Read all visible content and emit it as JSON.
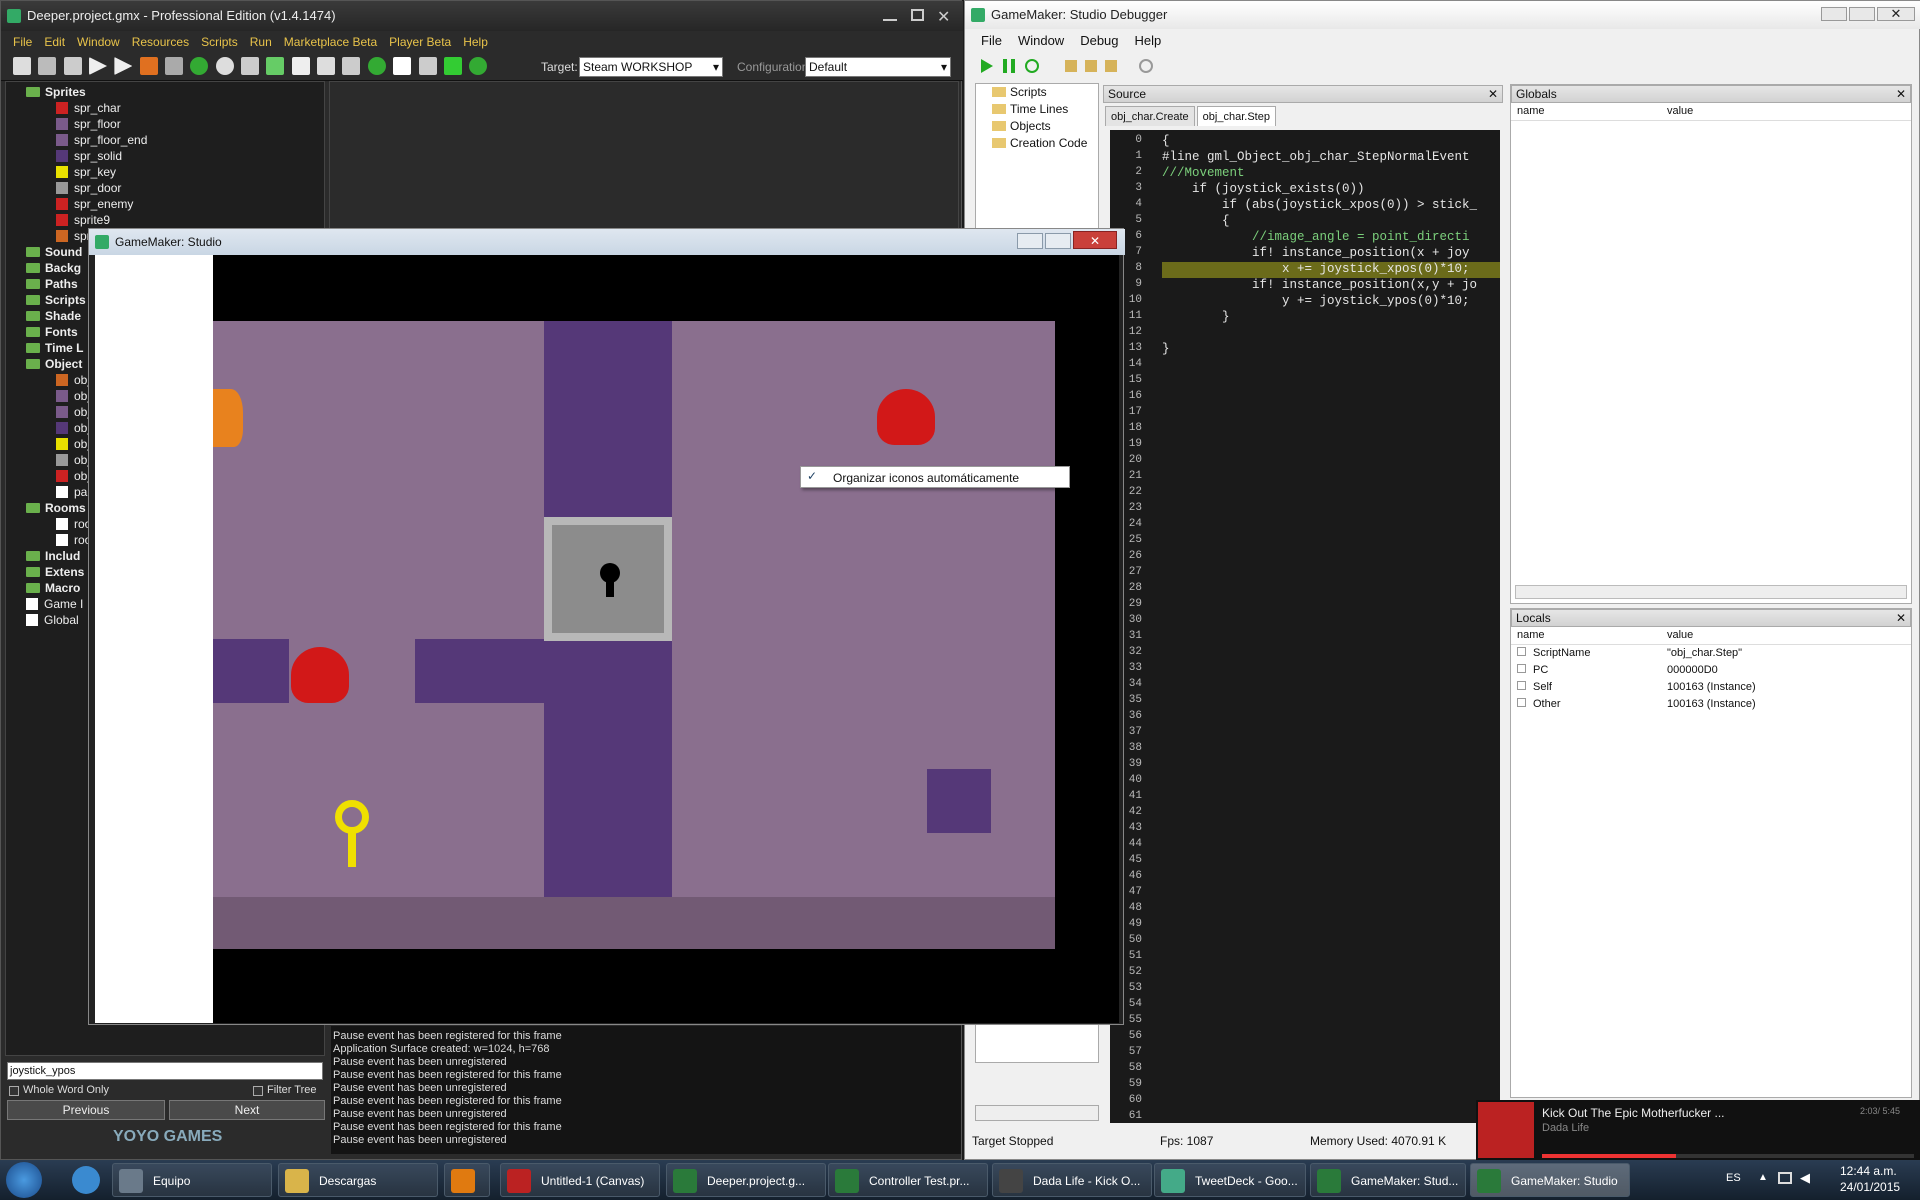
{
  "ide": {
    "title": "Deeper.project.gmx  -  Professional Edition (v1.4.1474)",
    "menu": [
      "File",
      "Edit",
      "Window",
      "Resources",
      "Scripts",
      "Run",
      "Marketplace Beta",
      "Player Beta",
      "Help"
    ],
    "target_label": "Target:",
    "target_value": "Steam WORKSHOP",
    "config_label": "Configuration:",
    "config_value": "Default",
    "tree": [
      {
        "t": "Sprites",
        "lvl": 0,
        "kind": "folder"
      },
      {
        "t": "spr_char",
        "lvl": 1,
        "kind": "spr",
        "c": "#cc2222"
      },
      {
        "t": "spr_floor",
        "lvl": 1,
        "kind": "spr",
        "c": "#7a5a8a"
      },
      {
        "t": "spr_floor_end",
        "lvl": 1,
        "kind": "spr",
        "c": "#7a5a8a"
      },
      {
        "t": "spr_solid",
        "lvl": 1,
        "kind": "spr",
        "c": "#553878"
      },
      {
        "t": "spr_key",
        "lvl": 1,
        "kind": "spr",
        "c": "#e8e000"
      },
      {
        "t": "spr_door",
        "lvl": 1,
        "kind": "spr",
        "c": "#999"
      },
      {
        "t": "spr_enemy",
        "lvl": 1,
        "kind": "spr",
        "c": "#cc2222"
      },
      {
        "t": "sprite9",
        "lvl": 1,
        "kind": "spr",
        "c": "#cc2222"
      },
      {
        "t": "spr",
        "lvl": 1,
        "kind": "spr",
        "c": "#cc6622"
      },
      {
        "t": "Sound",
        "lvl": 0,
        "kind": "folder"
      },
      {
        "t": "Backg",
        "lvl": 0,
        "kind": "folder"
      },
      {
        "t": "Paths",
        "lvl": 0,
        "kind": "folder"
      },
      {
        "t": "Scripts",
        "lvl": 0,
        "kind": "folder"
      },
      {
        "t": "Shade",
        "lvl": 0,
        "kind": "folder"
      },
      {
        "t": "Fonts",
        "lvl": 0,
        "kind": "folder"
      },
      {
        "t": "Time L",
        "lvl": 0,
        "kind": "folder"
      },
      {
        "t": "Object",
        "lvl": 0,
        "kind": "folder"
      },
      {
        "t": "obj",
        "lvl": 1,
        "kind": "spr",
        "c": "#cc6622"
      },
      {
        "t": "obj",
        "lvl": 1,
        "kind": "spr",
        "c": "#7a5a8a"
      },
      {
        "t": "obj",
        "lvl": 1,
        "kind": "spr",
        "c": "#7a5a8a"
      },
      {
        "t": "obj",
        "lvl": 1,
        "kind": "spr",
        "c": "#553878"
      },
      {
        "t": "obj",
        "lvl": 1,
        "kind": "spr",
        "c": "#e8e000"
      },
      {
        "t": "obj",
        "lvl": 1,
        "kind": "spr",
        "c": "#999"
      },
      {
        "t": "obj",
        "lvl": 1,
        "kind": "spr",
        "c": "#cc2222"
      },
      {
        "t": "par",
        "lvl": 1,
        "kind": "spr",
        "c": "#fff"
      },
      {
        "t": "Rooms",
        "lvl": 0,
        "kind": "folder"
      },
      {
        "t": "roo",
        "lvl": 1,
        "kind": "spr",
        "c": "#fff"
      },
      {
        "t": "roo",
        "lvl": 1,
        "kind": "spr",
        "c": "#fff"
      },
      {
        "t": "Includ",
        "lvl": 0,
        "kind": "folder"
      },
      {
        "t": "Extens",
        "lvl": 0,
        "kind": "folder"
      },
      {
        "t": "Macro",
        "lvl": 0,
        "kind": "folder"
      },
      {
        "t": "Game I",
        "lvl": 0,
        "kind": "spr",
        "c": "#fff"
      },
      {
        "t": "Global",
        "lvl": 0,
        "kind": "spr",
        "c": "#fff"
      }
    ],
    "search_value": "joystick_ypos",
    "whole_word": "Whole Word Only",
    "filter_tree": "Filter Tree",
    "prev": "Previous",
    "next": "Next",
    "logo": "YOYO GAMES",
    "output": [
      "Pause event has been registered for this frame",
      "Application Surface created: w=1024, h=768",
      "Pause event has been unregistered",
      "Pause event has been registered for this frame",
      "Pause event has been unregistered",
      "Pause event has been registered for this frame",
      "Pause event has been unregistered",
      "Pause event has been registered for this frame",
      "Pause event has been unregistered"
    ]
  },
  "game": {
    "title": "GameMaker: Studio",
    "context_item": "Organizar iconos automáticamente"
  },
  "debugger": {
    "title": "GameMaker: Studio Debugger",
    "menu": [
      "File",
      "Window",
      "Debug",
      "Help"
    ],
    "tree": [
      "Scripts",
      "Time Lines",
      "Objects",
      "Creation Code"
    ],
    "source_label": "Source",
    "tabs": [
      "obj_char.Create",
      "obj_char.Step"
    ],
    "code": [
      "{",
      "#line gml_Object_obj_char_StepNormalEvent",
      "///Movement",
      "    if (joystick_exists(0))",
      "        if (abs(joystick_xpos(0)) > stick_",
      "        {",
      "            //image_angle = point_directi",
      "            if! instance_position(x + joy",
      "                x += joystick_xpos(0)*10;",
      "            if! instance_position(x,y + jo",
      "                y += joystick_ypos(0)*10;",
      "        }",
      "",
      "}"
    ],
    "line_count": 62,
    "highlight_line": 8,
    "globals": {
      "title": "Globals",
      "cols": [
        "name",
        "value"
      ]
    },
    "locals": {
      "title": "Locals",
      "cols": [
        "name",
        "value"
      ],
      "rows": [
        {
          "name": "ScriptName",
          "value": "\"obj_char.Step\""
        },
        {
          "name": "PC",
          "value": "000000D0"
        },
        {
          "name": "Self",
          "value": "100163 (Instance)"
        },
        {
          "name": "Other",
          "value": "100163 (Instance)"
        }
      ]
    },
    "status": {
      "state": "Target Stopped",
      "fps": "Fps: 1087",
      "memory": "Memory Used: 4070.91 K"
    }
  },
  "notification": {
    "title": "Kick Out The Epic Motherfucker ...",
    "artist": "Dada Life",
    "time": "2:03/ 5:45"
  },
  "taskbar": {
    "items": [
      {
        "label": "Equipo",
        "c": "#6a7a8a"
      },
      {
        "label": "Descargas",
        "c": "#d9b44a"
      },
      {
        "label": "",
        "c": "#e07a10"
      },
      {
        "label": "Untitled-1 (Canvas)",
        "c": "#b22"
      },
      {
        "label": "Deeper.project.g...",
        "c": "#2a7a3a"
      },
      {
        "label": "Controller Test.pr...",
        "c": "#2a7a3a"
      },
      {
        "label": "Dada Life - Kick O...",
        "c": "#444"
      },
      {
        "label": "TweetDeck - Goo...",
        "c": "#4a8"
      },
      {
        "label": "GameMaker: Stud...",
        "c": "#2a7a3a"
      },
      {
        "label": "GameMaker: Studio",
        "c": "#2a7a3a"
      }
    ],
    "lang": "ES",
    "time": "12:44 a.m.",
    "date": "24/01/2015"
  }
}
